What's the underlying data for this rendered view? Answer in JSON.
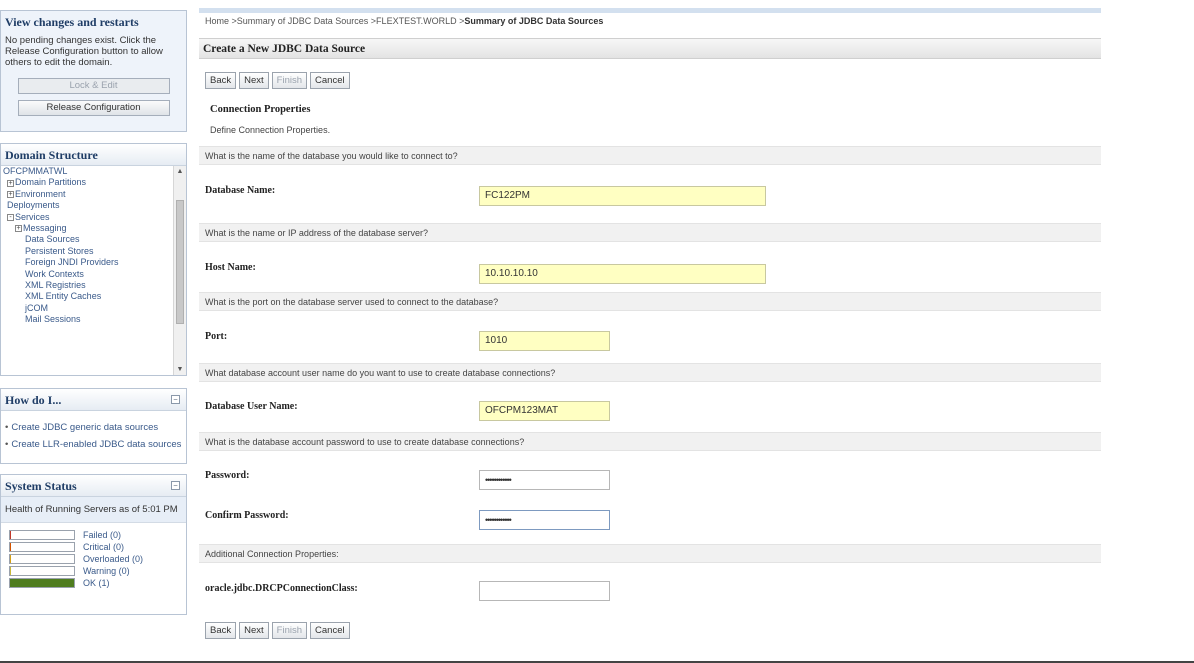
{
  "sidebar": {
    "changes": {
      "title": "View changes and restarts",
      "message": "No pending changes exist. Click the Release Configuration button to allow others to edit the domain.",
      "lock_label": "Lock & Edit",
      "release_label": "Release Configuration"
    },
    "domain_structure": {
      "title": "Domain Structure",
      "items": [
        {
          "label": "OFCPMMATWL",
          "level": 0,
          "expander": ""
        },
        {
          "label": "Domain Partitions",
          "level": 1,
          "expander": "+"
        },
        {
          "label": "Environment",
          "level": 1,
          "expander": "+"
        },
        {
          "label": "Deployments",
          "level": 1,
          "expander": ""
        },
        {
          "label": "Services",
          "level": 1,
          "expander": "-"
        },
        {
          "label": "Messaging",
          "level": 2,
          "expander": "+"
        },
        {
          "label": "Data Sources",
          "level": 3,
          "expander": ""
        },
        {
          "label": "Persistent Stores",
          "level": 3,
          "expander": ""
        },
        {
          "label": "Foreign JNDI Providers",
          "level": 3,
          "expander": ""
        },
        {
          "label": "Work Contexts",
          "level": 3,
          "expander": ""
        },
        {
          "label": "XML Registries",
          "level": 3,
          "expander": ""
        },
        {
          "label": "XML Entity Caches",
          "level": 3,
          "expander": ""
        },
        {
          "label": "jCOM",
          "level": 3,
          "expander": ""
        },
        {
          "label": "Mail Sessions",
          "level": 3,
          "expander": ""
        }
      ]
    },
    "how_do_i": {
      "title": "How do I...",
      "items": [
        "Create JDBC generic data sources",
        "Create LLR-enabled JDBC data sources"
      ]
    },
    "system_status": {
      "title": "System Status",
      "subtitle": "Health of Running Servers as of  5:01 PM",
      "rows": [
        {
          "label": "Failed (0)",
          "color": "#c0392b",
          "fill": 0.02
        },
        {
          "label": "Critical (0)",
          "color": "#d35400",
          "fill": 0.02
        },
        {
          "label": "Overloaded (0)",
          "color": "#d4a017",
          "fill": 0.02
        },
        {
          "label": "Warning (0)",
          "color": "#c9b93a",
          "fill": 0.02
        },
        {
          "label": "OK (1)",
          "color": "#4f7d1f",
          "fill": 1.0
        }
      ]
    }
  },
  "breadcrumb": {
    "prefix": "Home >Summary of JDBC Data Sources >FLEXTEST.WORLD >",
    "current": "Summary of JDBC Data Sources"
  },
  "page": {
    "title": "Create a New JDBC Data Source",
    "buttons": {
      "back": "Back",
      "next": "Next",
      "finish": "Finish",
      "cancel": "Cancel"
    },
    "section_title": "Connection Properties",
    "section_desc": "Define Connection Properties.",
    "fields": {
      "db_name": {
        "question": "What is the name of the database you would like to connect to?",
        "label": "Database Name:",
        "value": "FC122PM"
      },
      "host": {
        "question": "What is the name or IP address of the database server?",
        "label": "Host Name:",
        "value": "10.10.10.10"
      },
      "port": {
        "question": "What is the port on the database server used to connect to the database?",
        "label": "Port:",
        "value": "1010"
      },
      "user": {
        "question": "What database account user name do you want to use to create database connections?",
        "label": "Database User Name:",
        "value": "OFCPM123MAT"
      },
      "password": {
        "question": "What is the database account password to use to create database connections?",
        "label": "Password:",
        "value": "••••••••••••"
      },
      "confirm": {
        "label": "Confirm Password:",
        "value": "••••••••••••"
      },
      "additional": {
        "question": "Additional Connection Properties:",
        "label": "oracle.jdbc.DRCPConnectionClass:",
        "value": ""
      }
    }
  }
}
